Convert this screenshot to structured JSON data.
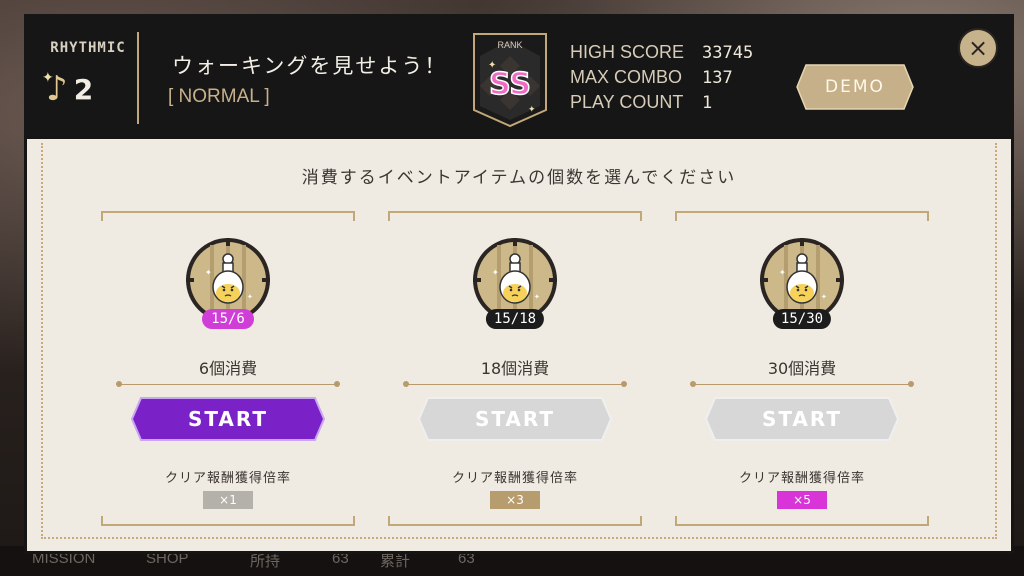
{
  "background_strip": {
    "mission": "MISSION",
    "shop": "SHOP",
    "owned_label": "所持",
    "owned_value": "63",
    "total_label": "累計",
    "total_value": "63"
  },
  "header": {
    "mode": "RHYTHMIC",
    "level": "2",
    "song_title": "ウォーキングを見せよう！",
    "difficulty": "[ NORMAL ]",
    "rank_label": "RANK",
    "rank_value": "SS",
    "stats": [
      {
        "label": "HIGH SCORE",
        "value": "33745"
      },
      {
        "label": "MAX COMBO",
        "value": "137"
      },
      {
        "label": "PLAY COUNT",
        "value": "1"
      }
    ],
    "demo_label": "DEMO",
    "close_label": "×"
  },
  "panel": {
    "prompt": "消費するイベントアイテムの個数を選んでください",
    "options": [
      {
        "count": "15/6",
        "count_color": "#d03ed8",
        "cost": "6個消費",
        "start": "START",
        "active": true,
        "rate_label": "クリア報酬獲得倍率",
        "rate": "×1",
        "rate_color": "#b4b0aa"
      },
      {
        "count": "15/18",
        "count_color": "#1c1c1c",
        "cost": "18個消費",
        "start": "START",
        "active": false,
        "rate_label": "クリア報酬獲得倍率",
        "rate": "×3",
        "rate_color": "#b79d6e"
      },
      {
        "count": "15/30",
        "count_color": "#1c1c1c",
        "cost": "30個消費",
        "start": "START",
        "active": false,
        "rate_label": "クリア報酬獲得倍率",
        "rate": "×5",
        "rate_color": "#d834d8"
      }
    ]
  },
  "colors": {
    "active_start": "#7a22c8",
    "inactive_start": "#d7d7d7",
    "gold": "#c2a878",
    "rank_pink": "#f06cc4"
  }
}
